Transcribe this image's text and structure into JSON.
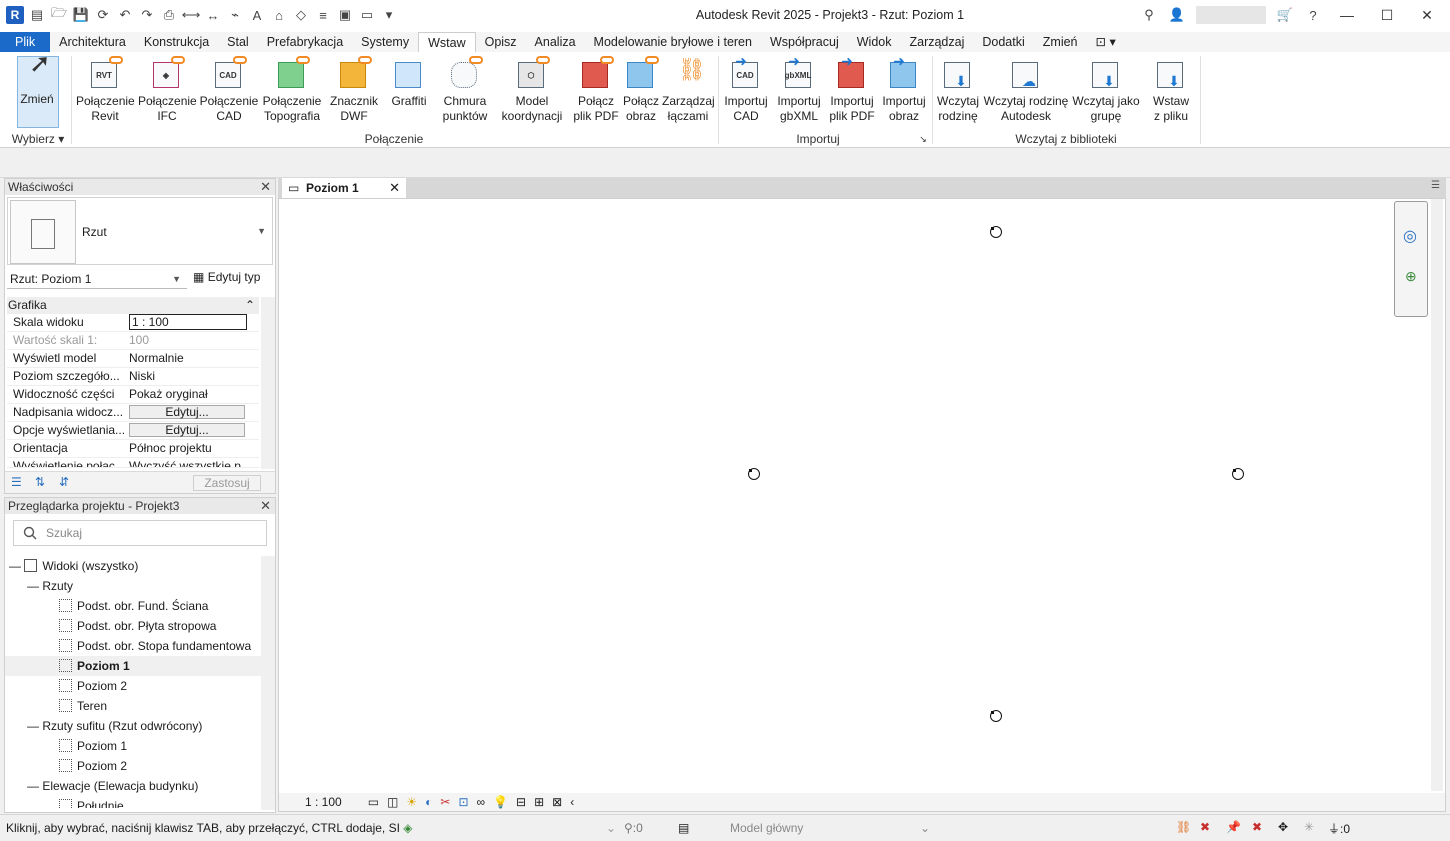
{
  "window": {
    "title": "Autodesk Revit 2025 - Projekt3 - Rzut: Poziom 1"
  },
  "menu": [
    "Plik",
    "Architektura",
    "Konstrukcja",
    "Stal",
    "Prefabrykacja",
    "Systemy",
    "Wstaw",
    "Opisz",
    "Analiza",
    "Modelowanie bryłowe i teren",
    "Współpracuj",
    "Widok",
    "Zarządzaj",
    "Dodatki",
    "Zmień"
  ],
  "ribbon": {
    "modify": "Zmień",
    "select": "Wybierz",
    "link_buttons": [
      "Połączenie\nRevit",
      "Połączenie\nIFC",
      "Połączenie\nCAD",
      "Połączenie\nTopografia",
      "Znacznik\nDWF",
      "Graffiti",
      "Chmura\npunktów",
      "Model\nkoordynacji",
      "Połącz\nplik PDF",
      "Połącz\nobraz",
      "Zarządzaj\nłączami"
    ],
    "import_buttons": [
      "Importuj\nCAD",
      "Importuj\ngbXML",
      "Importuj\nplik PDF",
      "Importuj\nobraz"
    ],
    "library_buttons": [
      "Wczytaj\nrodzinę",
      "Wczytaj rodzinę\nAutodesk",
      "Wczytaj jako\ngrupę",
      "Wstaw\nz pliku"
    ],
    "panels": {
      "link": "Połączenie",
      "import": "Importuj",
      "library": "Wczytaj z biblioteki"
    },
    "icon_text": {
      "revit": "RVT",
      "cad": "CAD",
      "gbxml": "gbXML"
    }
  },
  "properties": {
    "title": "Właściwości",
    "type_name": "Rzut",
    "selector": "Rzut: Poziom 1",
    "edit_type": "Edytuj typ",
    "group": "Grafika",
    "rows": [
      {
        "k": "Skala widoku",
        "v": "1 : 100"
      },
      {
        "k": "Wartość skali    1:",
        "v": "100"
      },
      {
        "k": "Wyświetl model",
        "v": "Normalnie"
      },
      {
        "k": "Poziom szczegóło...",
        "v": "Niski"
      },
      {
        "k": "Widoczność części",
        "v": "Pokaż oryginał"
      },
      {
        "k": "Nadpisania widocz...",
        "v": "Edytuj..."
      },
      {
        "k": "Opcje wyświetlania...",
        "v": "Edytuj..."
      },
      {
        "k": "Orientacja",
        "v": "Północ projektu"
      },
      {
        "k": "Wyświetlenie połąc...",
        "v": "Wyczyść wszystkie p..."
      }
    ],
    "apply": "Zastosuj"
  },
  "browser": {
    "title": "Przeglądarka projektu - Projekt3",
    "search_placeholder": "Szukaj",
    "tree": [
      {
        "label": "Widoki (wszystko)",
        "level": 0
      },
      {
        "label": "Rzuty",
        "level": 1
      },
      {
        "label": "Podst. obr. Fund. Ściana",
        "level": 2
      },
      {
        "label": "Podst. obr. Płyta stropowa",
        "level": 2
      },
      {
        "label": "Podst. obr. Stopa fundamentowa",
        "level": 2
      },
      {
        "label": "Poziom 1",
        "level": 2
      },
      {
        "label": "Poziom 2",
        "level": 2
      },
      {
        "label": "Teren",
        "level": 2
      },
      {
        "label": "Rzuty sufitu (Rzut odwrócony)",
        "level": 1
      },
      {
        "label": "Poziom 1",
        "level": 2
      },
      {
        "label": "Poziom 2",
        "level": 2
      },
      {
        "label": "Elewacje (Elewacja budynku)",
        "level": 1
      },
      {
        "label": "Południe",
        "level": 2
      }
    ]
  },
  "view": {
    "tab": "Poziom 1",
    "scale": "1 : 100"
  },
  "status": {
    "hint": "Kliknij, aby wybrać, naciśnij klawisz TAB, aby przełączyć, CTRL dodaje, SI",
    "count_a": ":0",
    "model": "Model główny",
    "count_b": ":0"
  }
}
